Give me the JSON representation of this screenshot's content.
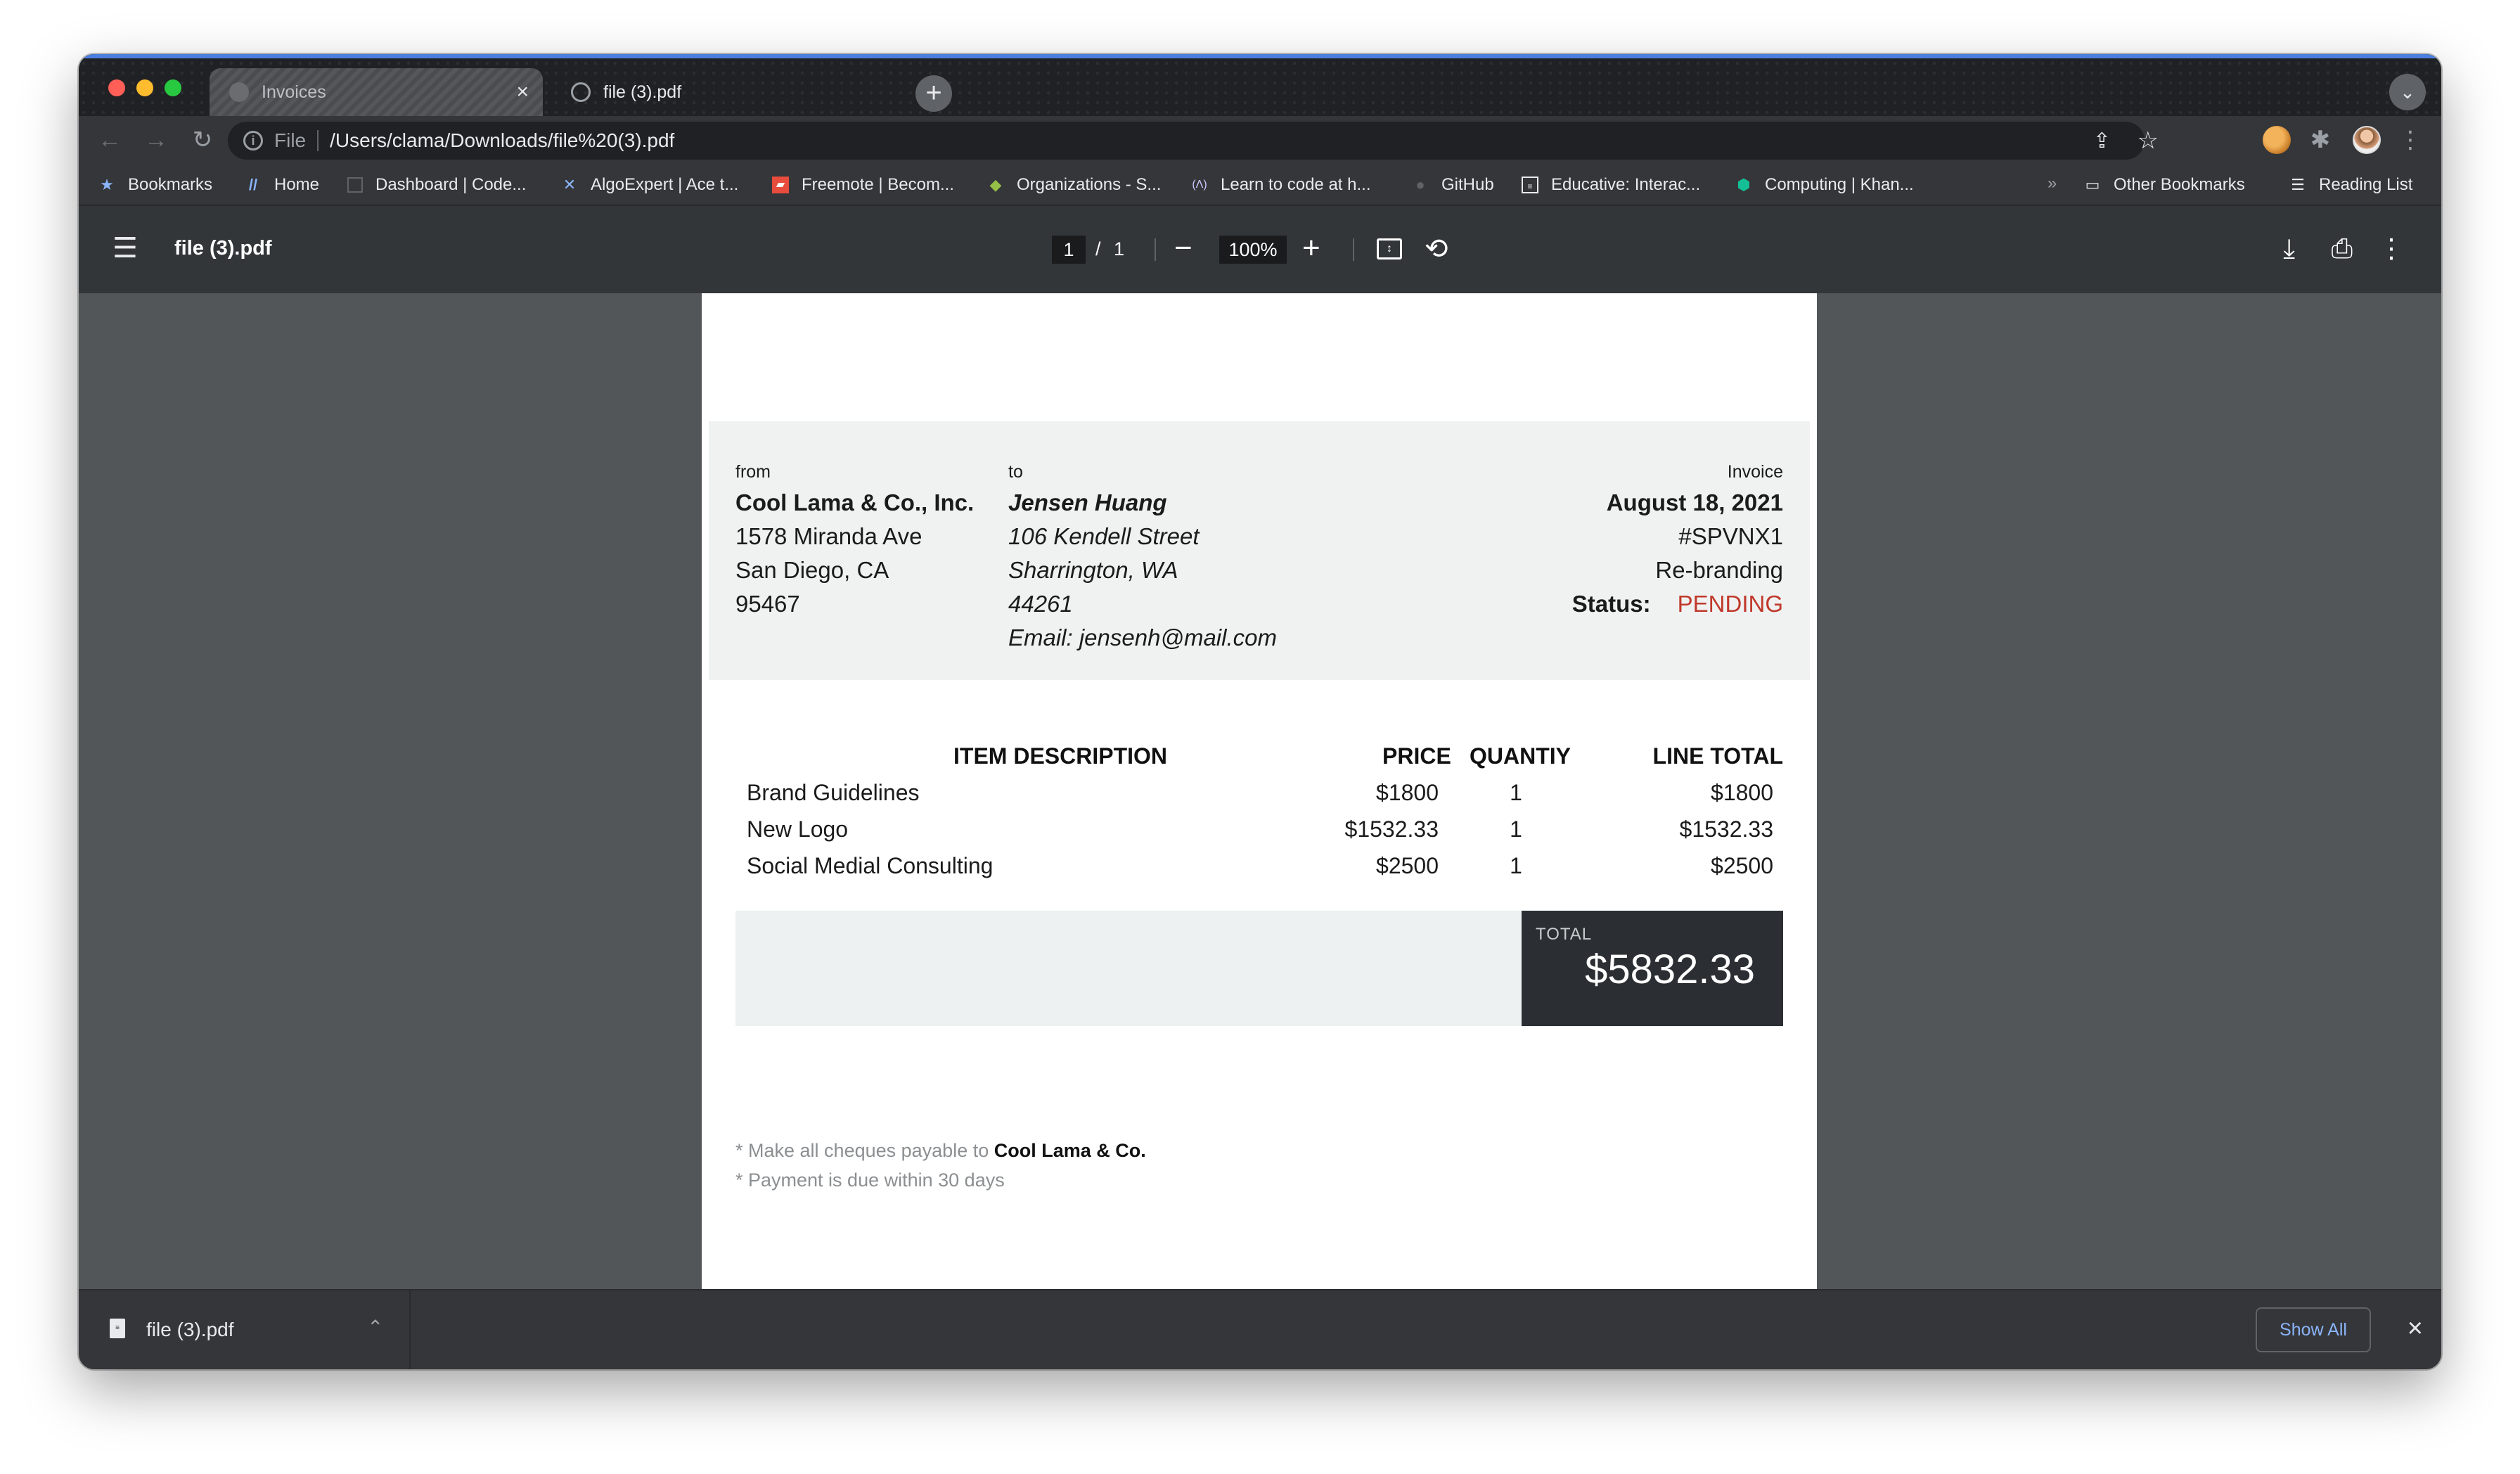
{
  "browser": {
    "tabs": [
      {
        "title": "Invoices",
        "active": false
      },
      {
        "title": "file (3).pdf",
        "active": true
      }
    ],
    "new_tab_symbol": "+",
    "address": {
      "scheme_label": "File",
      "url": "/Users/clama/Downloads/file%20(3).pdf"
    },
    "bookmarks": [
      {
        "label": "Bookmarks",
        "icon": "star-icon"
      },
      {
        "label": "Home",
        "icon": "slash-logo-icon"
      },
      {
        "label": "Dashboard | Code...",
        "icon": "code-icon"
      },
      {
        "label": "AlgoExpert | Ace t...",
        "icon": "algoexpert-icon"
      },
      {
        "label": "Freemote | Becom...",
        "icon": "freemote-icon"
      },
      {
        "label": "Organizations - S...",
        "icon": "shopify-icon"
      },
      {
        "label": "Learn to code at h...",
        "icon": "freecodecamp-icon"
      },
      {
        "label": "GitHub",
        "icon": "github-icon"
      },
      {
        "label": "Educative: Interac...",
        "icon": "educative-icon"
      },
      {
        "label": "Computing | Khan...",
        "icon": "khan-academy-icon"
      }
    ],
    "bookmarks_more": "»",
    "other_bookmarks": "Other Bookmarks",
    "reading_list": "Reading List"
  },
  "pdf_viewer": {
    "title": "file (3).pdf",
    "page_current": "1",
    "page_separator": "/",
    "page_total": "1",
    "zoom": "100%"
  },
  "invoice": {
    "from": {
      "label": "from",
      "company": "Cool Lama & Co., Inc.",
      "street": "1578 Miranda Ave",
      "city": "San Diego, CA",
      "zip": "95467"
    },
    "to": {
      "label": "to",
      "name": "Jensen Huang",
      "street": "106 Kendell Street",
      "city": "Sharrington, WA",
      "zip": "44261",
      "email": "Email: jensenh@mail.com"
    },
    "meta": {
      "label": "Invoice",
      "date": "August 18, 2021",
      "number": "#SPVNX1",
      "project": "Re-branding",
      "status_label": "Status:",
      "status_value": "PENDING",
      "status_color": "#c0392b"
    },
    "columns": {
      "description": "ITEM DESCRIPTION",
      "price": "PRICE",
      "quantity": "QUANTIY",
      "line_total": "LINE TOTAL"
    },
    "items": [
      {
        "description": "Brand Guidelines",
        "price": "$1800",
        "quantity": "1",
        "line_total": "$1800"
      },
      {
        "description": "New Logo",
        "price": "$1532.33",
        "quantity": "1",
        "line_total": "$1532.33"
      },
      {
        "description": "Social Medial Consulting",
        "price": "$2500",
        "quantity": "1",
        "line_total": "$2500"
      }
    ],
    "total_label": "TOTAL",
    "total_value": "$5832.33",
    "notes": {
      "cheques_prefix": "* Make all cheques payable to",
      "cheques_payee": "Cool Lama & Co.",
      "payment_terms": "* Payment is due within 30 days"
    }
  },
  "download_shelf": {
    "file_name": "file (3).pdf",
    "show_all": "Show All"
  }
}
